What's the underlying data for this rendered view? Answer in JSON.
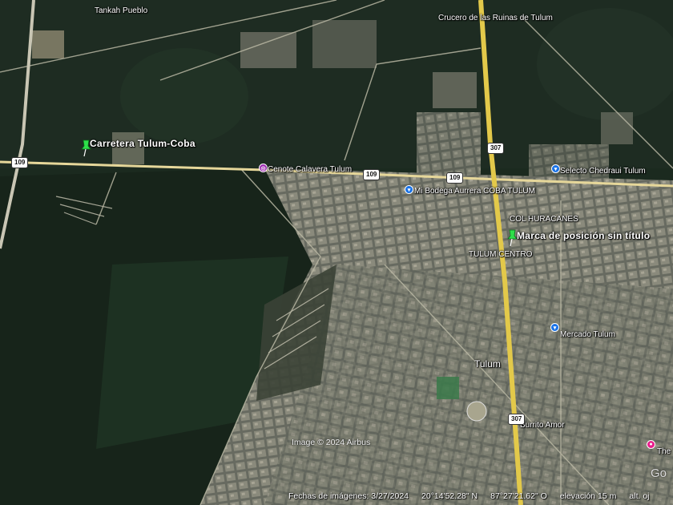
{
  "places": {
    "tankah": "Tankah Pueblo",
    "crucero": "Crucero de las Ruinas de Tulum",
    "carretera": "Carretera Tulum-Coba",
    "cenote": "Cenote Calavera Tulum",
    "bodega": "Mi Bodega Aurrera COBA TULUM",
    "chedraui": "Selecto Chedraui Tulum",
    "huracanes": "COL HURACANES",
    "marca": "Marca de posición sin título",
    "centro": "TULUM CENTRO",
    "mercado": "Mercado Tulum",
    "tulum": "Tulum",
    "burrito": "Burrito Amor",
    "the": "The"
  },
  "road_shields": {
    "r109a": "109",
    "r109b": "109",
    "r109c": "109",
    "r307a": "307",
    "r307b": "307"
  },
  "overlay": {
    "copyright": "Image © 2024 Airbus",
    "google_logo": "Go"
  },
  "status": {
    "date": "Fechas de imágenes: 3/27/2024",
    "lat": "20°14'52.28\" N",
    "lon": "87°27'21.62\" O",
    "elevation": "elevación   15 m",
    "alt": "alt. oj"
  },
  "colors": {
    "forest": "#1c2a20",
    "urban": "#5d6259",
    "road_yellow": "#e3c94a",
    "pin_green": "#2ee04a",
    "poi_blue": "#1a73e8",
    "poi_purple": "#9c27b0",
    "poi_pink": "#e91e8c"
  }
}
